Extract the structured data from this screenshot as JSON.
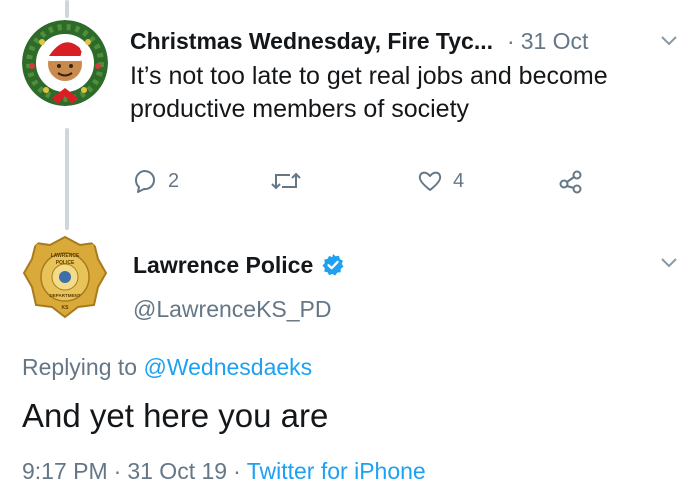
{
  "tweet1": {
    "author": "Christmas Wednesday, Fire Tyc...",
    "dot": "·",
    "date": "31 Oct",
    "text": "It’s not too late to get real jobs and become productive members of society",
    "replies": "2",
    "likes": "4"
  },
  "tweet2": {
    "author": "Lawrence Police",
    "handle": "@LawrenceKS_PD",
    "replying_prefix": "Replying to ",
    "replying_to": "@Wednesdaeks",
    "text": "And yet here you are",
    "time": "9:17 PM",
    "date": "31 Oct 19",
    "sep": "·",
    "source": "Twitter for iPhone",
    "badge_text_top": "LAWRENCE",
    "badge_text_mid": "POLICE",
    "badge_text_bottom": "DEPARTMENT",
    "badge_text_ks": "KS"
  },
  "colors": {
    "accent": "#1da1f2",
    "muted": "#657786",
    "text": "#14171a",
    "thread_line": "#ccd6dd"
  },
  "icons": [
    "reply-icon",
    "retweet-icon",
    "like-icon",
    "share-icon",
    "chevron-down-icon",
    "verified-badge-icon"
  ]
}
